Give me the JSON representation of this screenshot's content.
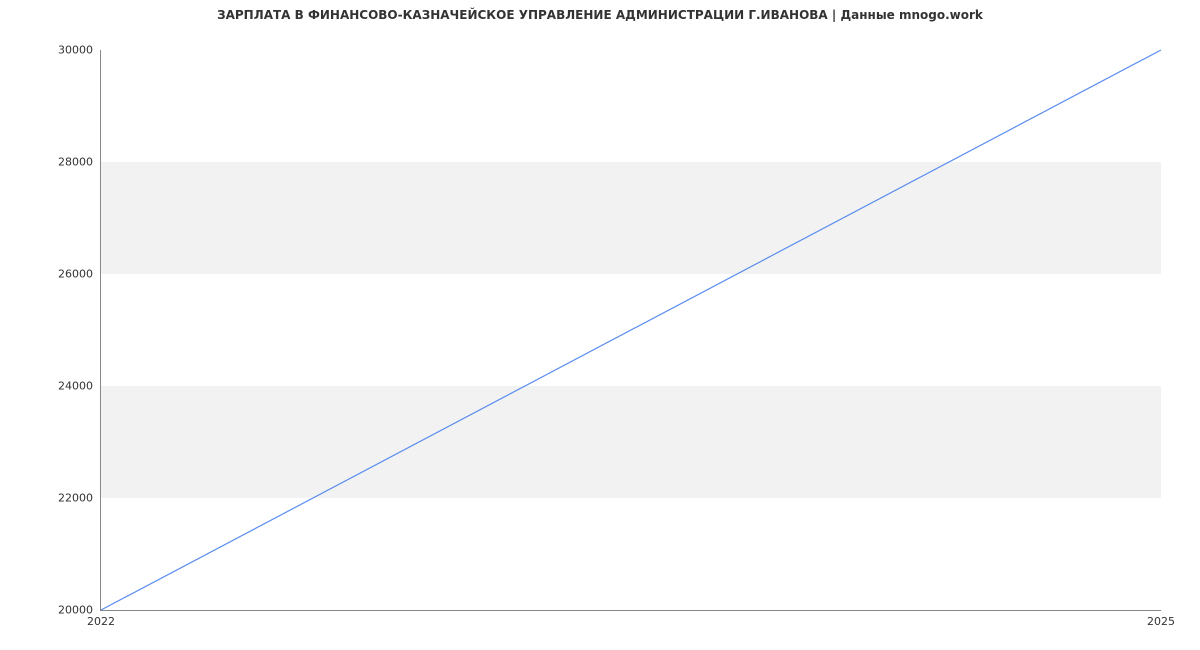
{
  "chart_data": {
    "type": "line",
    "title": "ЗАРПЛАТА В ФИНАНСОВО-КАЗНАЧЕЙСКОЕ УПРАВЛЕНИЕ АДМИНИСТРАЦИИ Г.ИВАНОВА | Данные mnogo.work",
    "x": [
      2022,
      2025
    ],
    "values": [
      20000,
      30000
    ],
    "xlabel": "",
    "ylabel": "",
    "x_ticks": [
      2022,
      2025
    ],
    "y_ticks": [
      20000,
      22000,
      24000,
      26000,
      28000,
      30000
    ],
    "xlim": [
      2022,
      2025
    ],
    "ylim": [
      20000,
      30000
    ],
    "line_color": "#5b8def",
    "band_color": "#f2f2f2"
  }
}
